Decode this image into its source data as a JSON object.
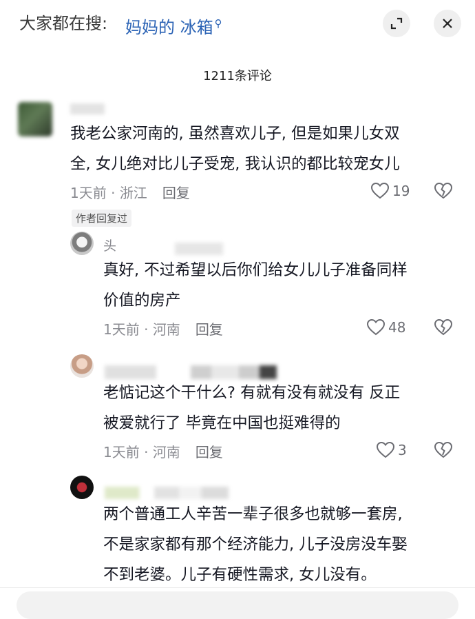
{
  "header": {
    "search_prefix": "大家都在搜:",
    "search_query": "妈妈的 冰箱",
    "search_icon": "search-icon",
    "expand_icon": "expand-icon",
    "close_icon": "close-icon"
  },
  "comment_count": "1211条评论",
  "comments": [
    {
      "text_lines": [
        "我老公家河南的, 虽然喜欢儿子, 但是如果儿女双",
        "全, 女儿绝对比儿子受宠, 我认识的都比较宠女儿"
      ],
      "time": "1天前",
      "location": "浙江",
      "reply_label": "回复",
      "likes": "19",
      "tag": "作者回复过"
    },
    {
      "username": "头",
      "text_lines": [
        "真好, 不过希望以后你们给女儿儿子准备同样",
        "价值的房产"
      ],
      "time": "1天前",
      "location": "河南",
      "reply_label": "回复",
      "likes": "48"
    },
    {
      "text_lines": [
        "老惦记这个干什么? 有就有没有就没有 反正",
        "被爱就行了 毕竟在中国也挺难得的"
      ],
      "time": "1天前",
      "location": "河南",
      "reply_label": "回复",
      "likes": "3"
    },
    {
      "text_lines": [
        "两个普通工人辛苦一辈子很多也就够一套房,",
        "不是家家都有那个经济能力, 儿子没房没车娶",
        "不到老婆。儿子有硬性需求, 女儿没有。"
      ]
    }
  ],
  "colors": {
    "query_link": "#2b63b5",
    "meta_gray": "#8a8b91"
  }
}
